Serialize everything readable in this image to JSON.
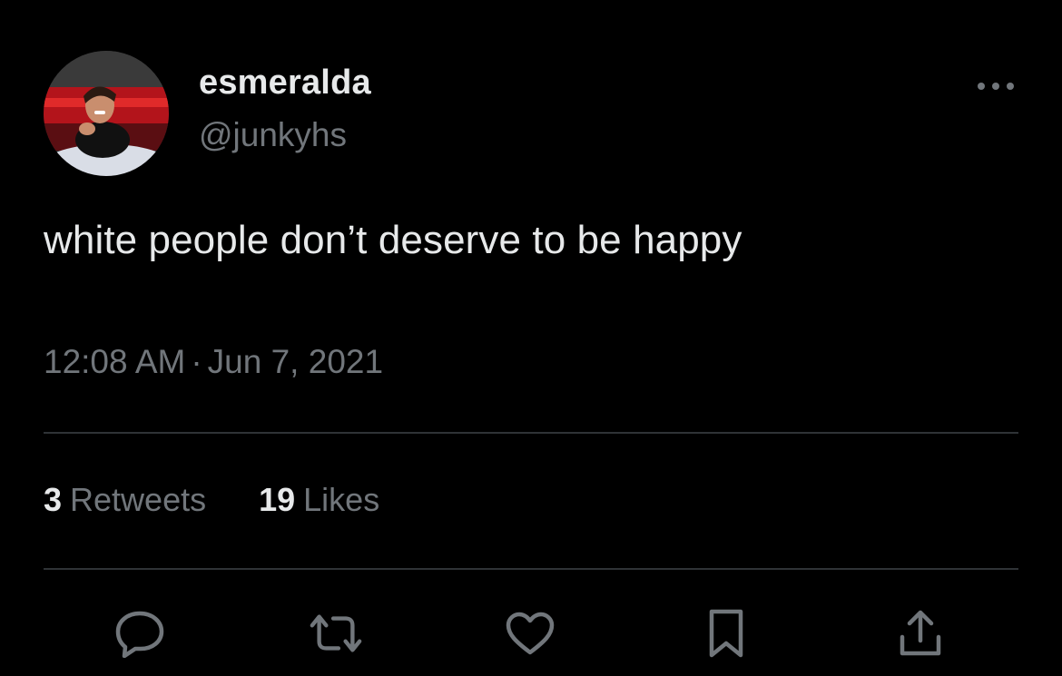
{
  "tweet": {
    "author": {
      "display_name": "esmeralda",
      "handle": "@junkyhs",
      "avatar_icon": "profile-photo"
    },
    "more_icon": "more-horizontal-icon",
    "text": "white people don’t deserve to be happy",
    "time": "12:08 AM",
    "separator": "·",
    "date": "Jun 7, 2021",
    "stats": {
      "retweets_count": "3",
      "retweets_label": "Retweets",
      "likes_count": "19",
      "likes_label": "Likes"
    },
    "actions": [
      {
        "name": "reply",
        "icon": "reply-icon"
      },
      {
        "name": "retweet",
        "icon": "retweet-icon"
      },
      {
        "name": "like",
        "icon": "heart-icon"
      },
      {
        "name": "bookmark",
        "icon": "bookmark-icon"
      },
      {
        "name": "share",
        "icon": "share-icon"
      }
    ]
  },
  "colors": {
    "background": "#000000",
    "primary_text": "#e7e9ea",
    "secondary_text": "#71767b",
    "divider": "#2f3336"
  }
}
